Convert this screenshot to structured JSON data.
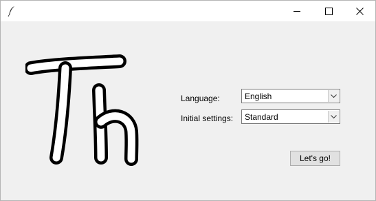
{
  "window": {
    "icons": {
      "app": "feather-icon",
      "minimize": "minimize-icon",
      "maximize": "maximize-icon",
      "close": "close-icon"
    }
  },
  "logo": {
    "text": "Th"
  },
  "form": {
    "language_label": "Language:",
    "language_value": "English",
    "settings_label": "Initial settings:",
    "settings_value": "Standard",
    "submit_label": "Let's go!"
  }
}
